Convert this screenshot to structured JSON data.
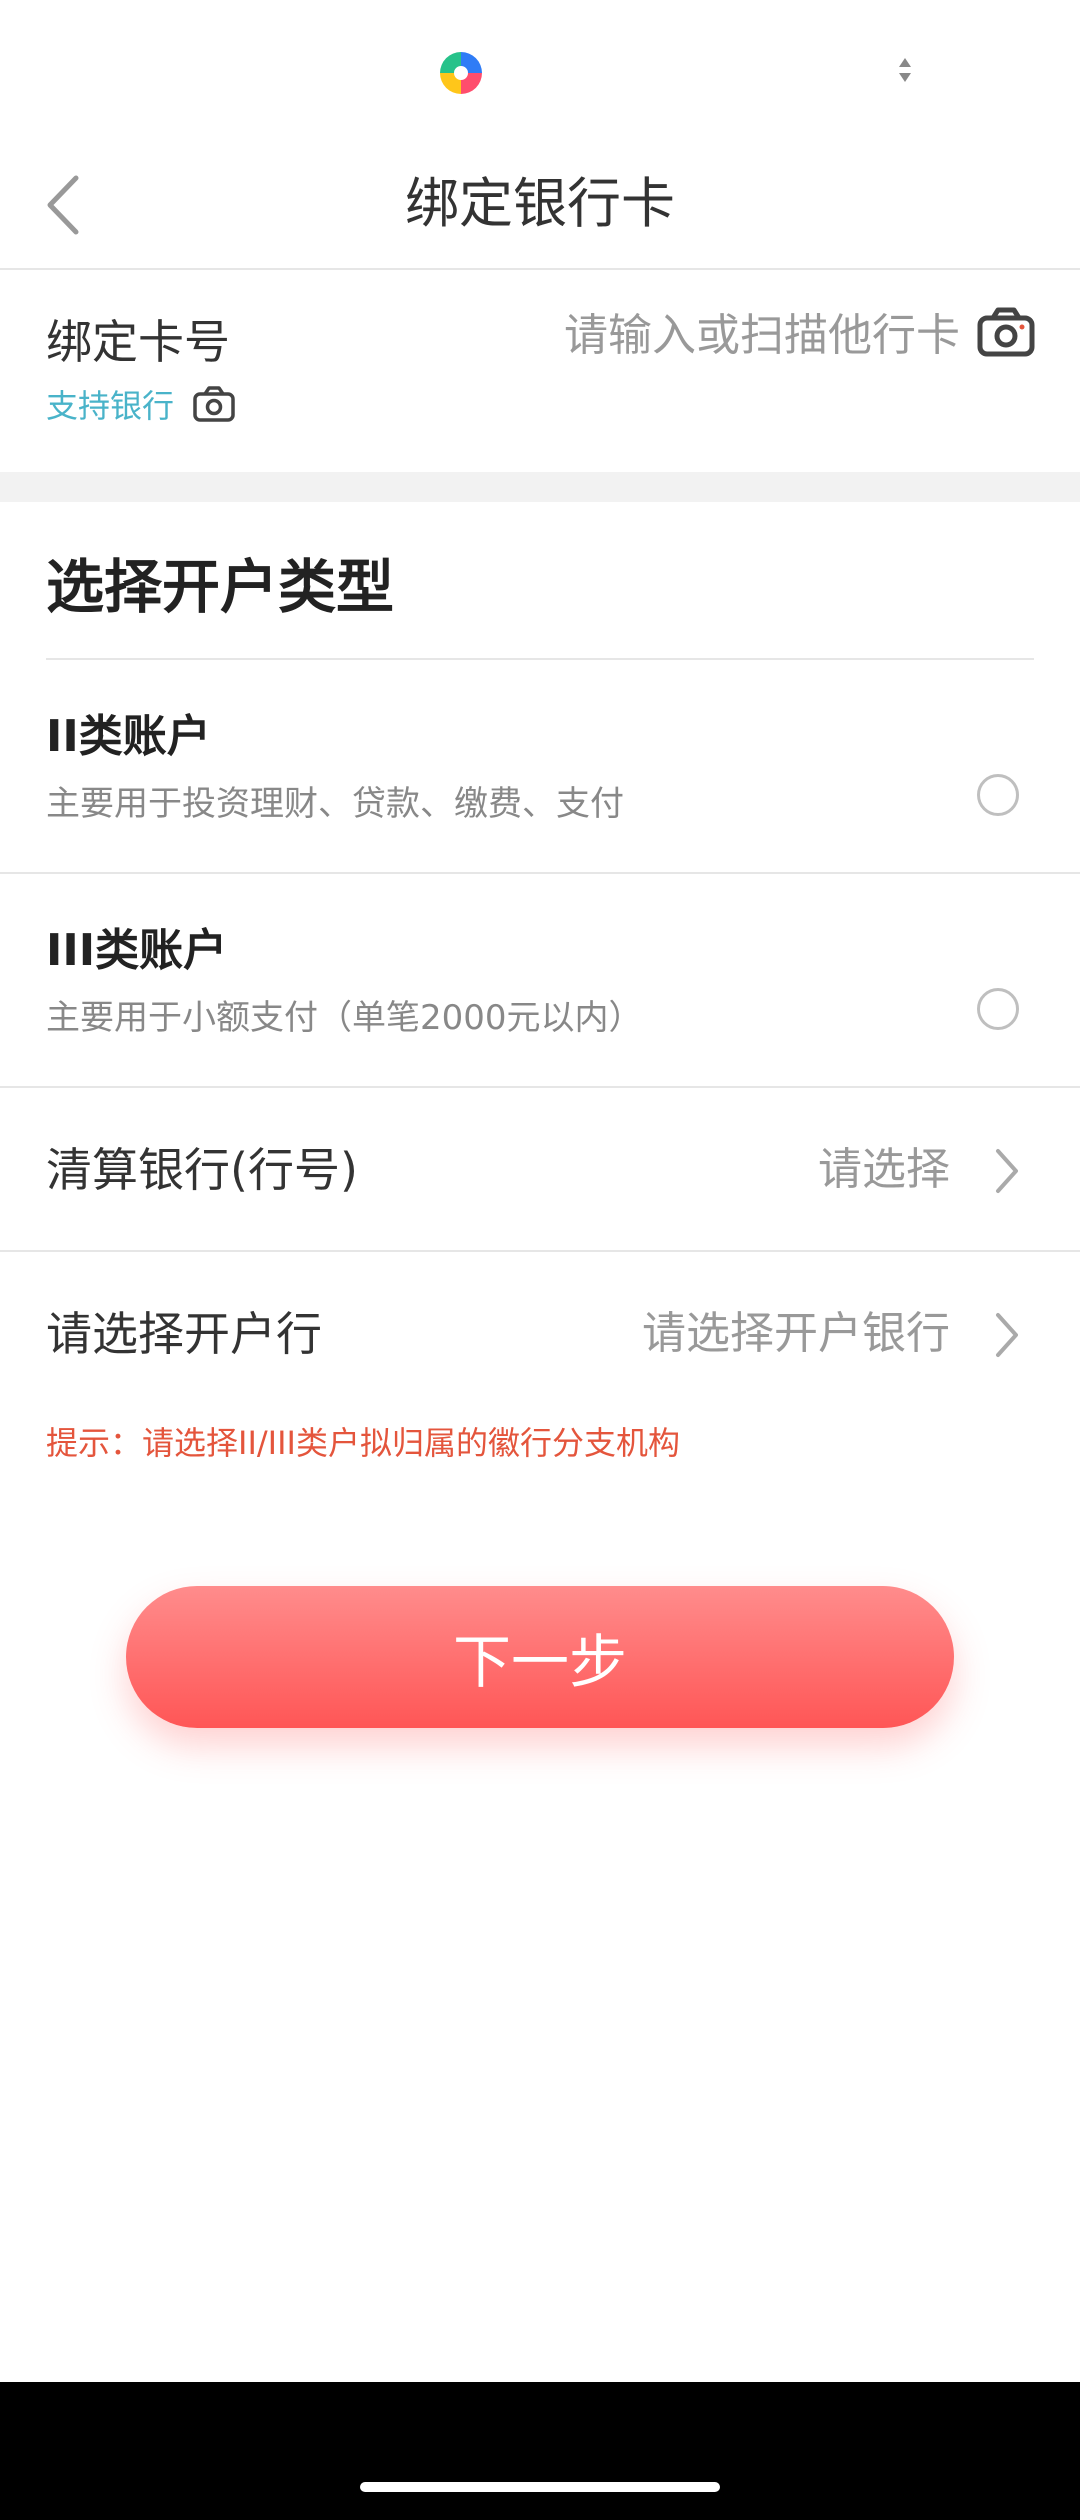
{
  "header": {
    "title": "绑定银行卡"
  },
  "card": {
    "label": "绑定卡号",
    "placeholder": "请输入或扫描他行卡",
    "support_link": "支持银行"
  },
  "account_type": {
    "title": "选择开户类型",
    "options": [
      {
        "title": "II类账户",
        "desc": "主要用于投资理财、贷款、缴费、支付",
        "selected": false
      },
      {
        "title": "III类账户",
        "desc": "主要用于小额支付（单笔2000元以内）",
        "selected": false
      }
    ]
  },
  "clearing_bank": {
    "label": "清算银行(行号)",
    "value": "请选择"
  },
  "open_branch": {
    "label": "请选择开户行",
    "value": "请选择开户银行"
  },
  "hint": "提示：请选择II/III类户拟归属的徽行分支机构",
  "next_button": {
    "label": "下一步"
  },
  "colors": {
    "accent_red": "#ff5a5a",
    "hint_red": "#e4553c",
    "link_teal": "#49b3c9",
    "placeholder_gray": "#999999"
  },
  "icons": {
    "status_app": "app-logo-icon",
    "status_sort": "sort-arrows-icon",
    "back": "chevron-left-icon",
    "camera": "camera-icon",
    "row_arrow": "chevron-right-icon"
  }
}
